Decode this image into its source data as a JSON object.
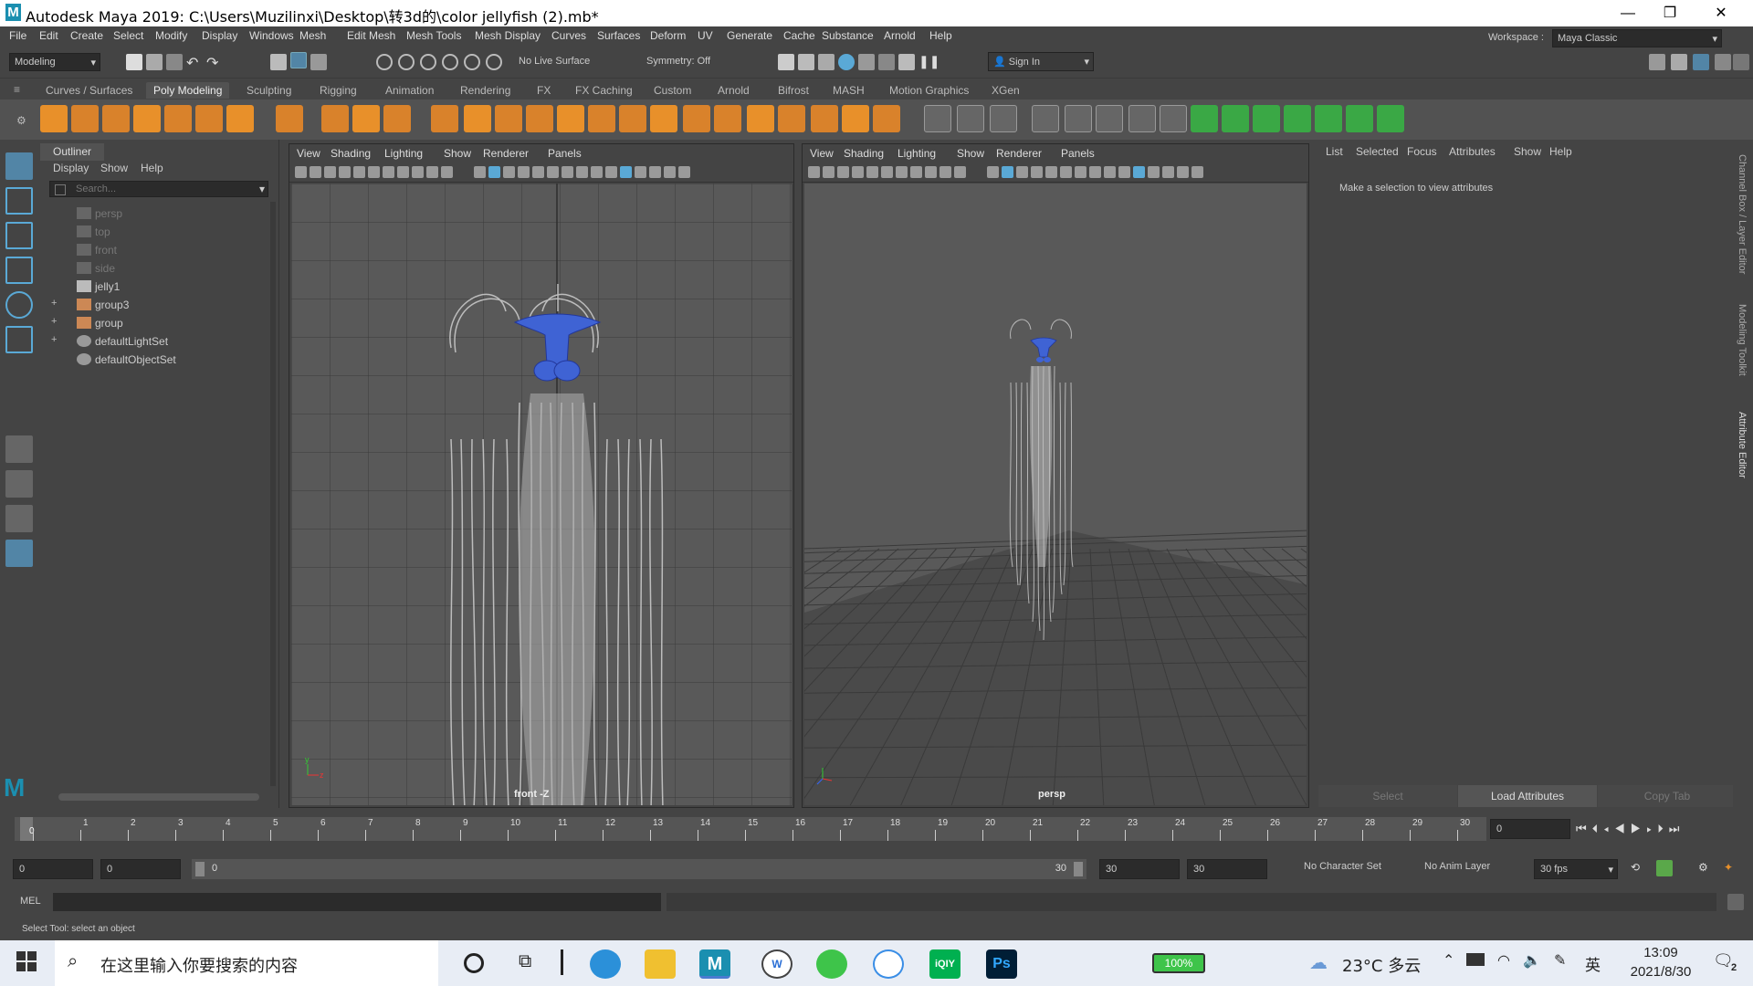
{
  "window": {
    "title": "Autodesk Maya 2019: C:\\Users\\Muzilinxi\\Desktop\\转3d的\\color jellyfish (2).mb*",
    "logo": "M",
    "minimize": "—",
    "maximize": "❐",
    "close": "✕"
  },
  "menu": [
    "File",
    "Edit",
    "Create",
    "Select",
    "Modify",
    "Display",
    "Windows",
    "Mesh",
    "Edit Mesh",
    "Mesh Tools",
    "Mesh Display",
    "Curves",
    "Surfaces",
    "Deform",
    "UV",
    "Generate",
    "Cache",
    "Substance",
    "Arnold",
    "Help"
  ],
  "status": {
    "menuset": "Modeling",
    "live_surface": "No Live Surface",
    "symmetry": "Symmetry: Off",
    "signin": "Sign In",
    "workspace_label": "Workspace :",
    "workspace": "Maya Classic"
  },
  "shelf_tabs": [
    "Curves / Surfaces",
    "Poly Modeling",
    "Sculpting",
    "Rigging",
    "Animation",
    "Rendering",
    "FX",
    "FX Caching",
    "Custom",
    "Arnold",
    "Bifrost",
    "MASH",
    "Motion Graphics",
    "XGen"
  ],
  "shelf_active": "Poly Modeling",
  "outliner": {
    "title": "Outliner",
    "menu": [
      "Display",
      "Show",
      "Help"
    ],
    "search_placeholder": "Search...",
    "items": [
      {
        "label": "persp",
        "dim": true,
        "expand": ""
      },
      {
        "label": "top",
        "dim": true,
        "expand": ""
      },
      {
        "label": "front",
        "dim": true,
        "expand": ""
      },
      {
        "label": "side",
        "dim": true,
        "expand": ""
      },
      {
        "label": "jelly1",
        "dim": false,
        "expand": ""
      },
      {
        "label": "group3",
        "dim": false,
        "expand": "+"
      },
      {
        "label": "group",
        "dim": false,
        "expand": "+"
      },
      {
        "label": "defaultLightSet",
        "dim": false,
        "expand": "+"
      },
      {
        "label": "defaultObjectSet",
        "dim": false,
        "expand": ""
      }
    ]
  },
  "viewport_menu": [
    "View",
    "Shading",
    "Lighting",
    "Show",
    "Renderer",
    "Panels"
  ],
  "viewport_left": {
    "label": "front -Z"
  },
  "viewport_right": {
    "label": "persp"
  },
  "attribute_editor": {
    "menu": [
      "List",
      "Selected",
      "Focus",
      "Attributes",
      "Show",
      "Help"
    ],
    "message": "Make a selection to view attributes",
    "buttons": {
      "select": "Select",
      "load": "Load Attributes",
      "copy": "Copy Tab"
    }
  },
  "side_tabs": [
    "Channel Box / Layer Editor",
    "Modeling Toolkit",
    "Attribute Editor"
  ],
  "timeline": {
    "ticks": [
      "0",
      "1",
      "2",
      "3",
      "4",
      "5",
      "6",
      "7",
      "8",
      "9",
      "10",
      "11",
      "12",
      "13",
      "14",
      "15",
      "16",
      "17",
      "18",
      "19",
      "20",
      "21",
      "22",
      "23",
      "24",
      "25",
      "26",
      "27",
      "28",
      "29",
      "30"
    ],
    "current_frame": "0"
  },
  "range": {
    "start": "0",
    "playback_start": "0",
    "slider_start": "0",
    "slider_end": "30",
    "playback_end": "30",
    "end": "30",
    "character_set": "No Character Set",
    "anim_layer": "No Anim Layer",
    "fps": "30 fps"
  },
  "command_line": {
    "label": "MEL"
  },
  "help_line": "Select Tool: select an object",
  "taskbar": {
    "search_placeholder": "在这里输入你要搜索的内容",
    "battery": "100%",
    "weather": "23°C 多云",
    "ime": "英",
    "time": "13:09",
    "date": "2021/8/30",
    "notifications": "2"
  },
  "colors": {
    "accent": "#5285a6",
    "jelly_blue": "#3f63d4",
    "shelf_orange": "#e8902a",
    "shelf_green": "#3aa845"
  }
}
